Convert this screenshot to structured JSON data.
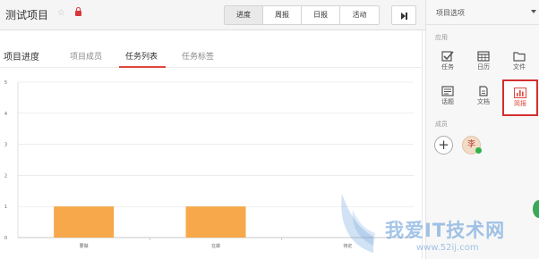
{
  "header": {
    "project_title": "测试项目",
    "views": [
      "进度",
      "周报",
      "日报",
      "活动"
    ],
    "active_view": "进度"
  },
  "tabs": {
    "section_title": "项目进度",
    "items": [
      "项目成员",
      "任务列表",
      "任务标签"
    ],
    "active": "任务列表"
  },
  "chart_data": {
    "type": "bar",
    "categories": [
      "要做",
      "在做",
      "待定"
    ],
    "values": [
      1,
      1,
      0
    ],
    "ylim": [
      0,
      5
    ],
    "yticks": [
      0,
      1,
      2,
      3,
      4,
      5
    ],
    "bar_color": "#f6a84a",
    "grid": true
  },
  "sidebar": {
    "title": "项目选项",
    "apps_label": "应用",
    "apps": [
      {
        "label": "任务",
        "icon": "checkbox-icon"
      },
      {
        "label": "日历",
        "icon": "calendar-icon"
      },
      {
        "label": "文件",
        "icon": "folder-icon"
      },
      {
        "label": "话题",
        "icon": "topic-icon"
      },
      {
        "label": "文档",
        "icon": "document-icon"
      },
      {
        "label": "简报",
        "icon": "bar-chart-icon"
      }
    ],
    "highlighted_app": "简报",
    "members_label": "成员",
    "member_initial": "李"
  },
  "watermark": {
    "text": "我爱IT技术网",
    "url": "www.52ij.com"
  },
  "colors": {
    "accent_red": "#e0463b",
    "bar_orange": "#f6a84a",
    "online_green": "#2fb24a"
  }
}
